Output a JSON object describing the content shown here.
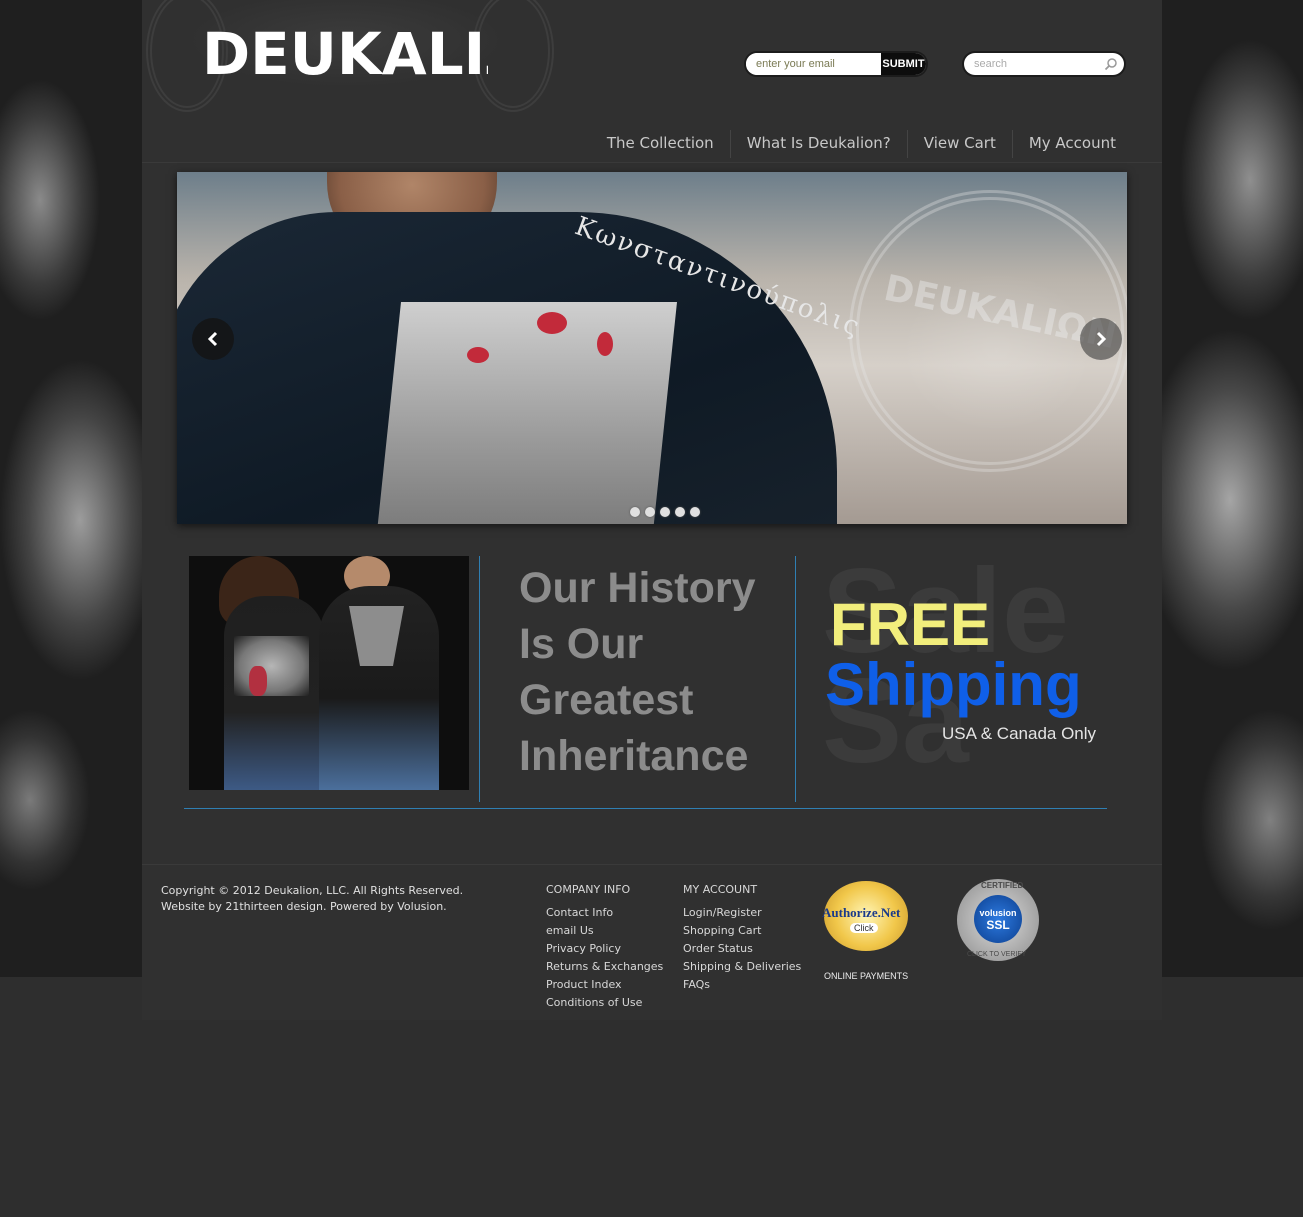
{
  "brand": {
    "logo_text": "DEUKALIΩN"
  },
  "header": {
    "email_placeholder": "enter your email",
    "submit_label": "SUBMIT",
    "search_placeholder": "search"
  },
  "nav": {
    "items": [
      {
        "label": "The Collection"
      },
      {
        "label": "What Is Deukalion?"
      },
      {
        "label": "View Cart"
      },
      {
        "label": "My Account"
      }
    ]
  },
  "slider": {
    "greek_text": "Κωνσταντινούπολις",
    "watermark_text": "DEUKALIΩN",
    "slide_count": 5
  },
  "promos": {
    "history_lines": [
      "Our History",
      "Is Our",
      "Greatest",
      "Inheritance"
    ],
    "free_label": "FREE",
    "shipping_label": "Shipping",
    "shipping_sub": "USA & Canada Only"
  },
  "footer": {
    "copyright_line1": "Copyright © 2012 Deukalion, LLC. All Rights Reserved.",
    "copyright_line2": "Website by 21thirteen design. Powered by Volusion.",
    "company_heading": "COMPANY INFO",
    "company_links": [
      "Contact Info",
      "email Us",
      "Privacy Policy",
      "Returns & Exchanges",
      "Product Index",
      "Conditions of Use"
    ],
    "account_heading": "MY ACCOUNT",
    "account_links": [
      "Login/Register",
      "Shopping Cart",
      "Order Status",
      "Shipping & Deliveries",
      "FAQs"
    ],
    "authorize_text": "Authorize.Net",
    "authorize_click": "Click",
    "authorize_caption": "ONLINE PAYMENTS",
    "ssl_certified": "CERTIFIED",
    "ssl_brand": "volusion",
    "ssl_label": "SSL",
    "ssl_click": "CLICK TO VERIFY"
  },
  "colors": {
    "page_bg": "#2e2e2e",
    "content_bg": "#303030",
    "accent_line": "#2f7fb3",
    "free_yellow": "#f2ee7c",
    "shipping_blue": "#0f5fe8"
  }
}
